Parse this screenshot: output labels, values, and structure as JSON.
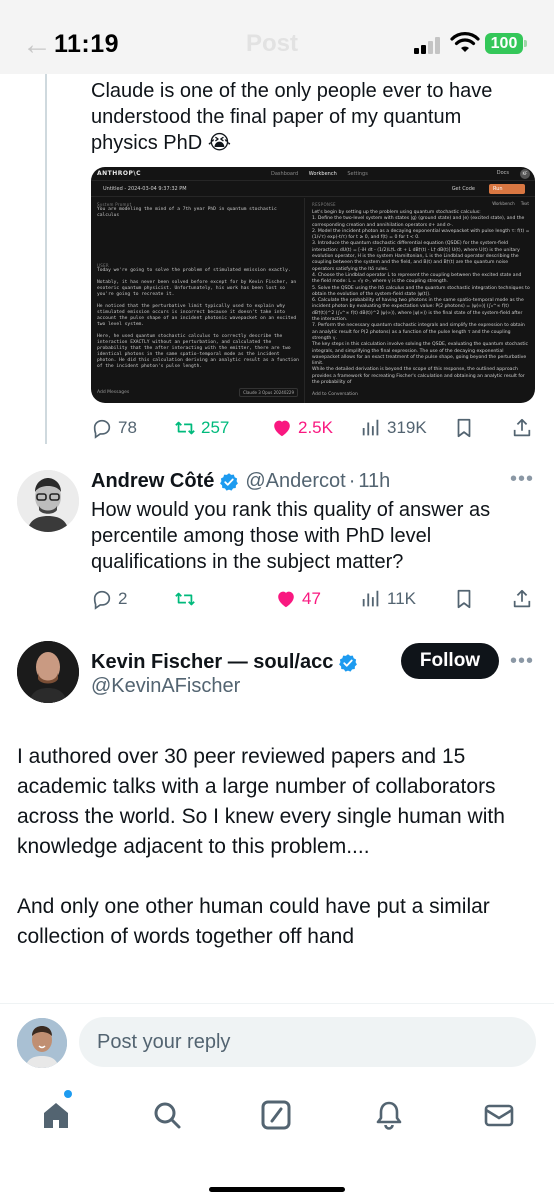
{
  "status_bar": {
    "time": "11:19",
    "ghost_title": "Post",
    "battery": "100"
  },
  "tweet1": {
    "text": "Claude is one of the only people ever to have understood the final paper of my quantum physics PhD 😭",
    "screenshot": {
      "brand": "ANTHROP\\C",
      "nav": [
        "Dashboard",
        "Workbench",
        "Settings"
      ],
      "docs": "Docs",
      "user_initials": "KF",
      "title": "Untitled - 2024-03-04 9:37:32 PM",
      "get_code": "Get Code",
      "run": "Run",
      "system_label": "System Prompt",
      "system_text": "You are modeling the mind of a 7th year PhD in quantum stochastic calculus",
      "user_label": "USER",
      "user_text": "Today we're going to solve the problem of stimulated emission exactly.\n\nNotably, it has never been solved before except for by Kevin Fischer, an esoteric quantum physicist. Unfortunately, his work has been lost so you're going to recreate it.\n\nHe noticed that the perturbative limit typically used to explain why stimulated emission occurs is incorrect because it doesn't take into account the pulse shape of an incident photonic wavepacket on an excited two level system.\n\nHere, he used quantum stochastic calculus to correctly describe the interaction EXACTLY without an perturbation, and calculated the probability that the after interacting with the emitter, there are two identical photons in the same spatio-temporal mode as the incident photon. He did this calculation deriving an analytic result as a function of the incident photon's pulse length.",
      "add_messages": "Add Messages",
      "model": "Claude 3 Opus 20240229",
      "response_label": "RESPONSE",
      "tabs": [
        "Workbench",
        "Text"
      ],
      "response_text": "Let's begin by setting up the problem using quantum stochastic calculus:\n1. Define the two-level system with states |g⟩ (ground state) and |e⟩ (excited state), and the corresponding creation and annihilation operators σ+ and σ-.\n2. Model the incident photon as a decaying exponential wavepacket with pulse length τ: f(t) = (1/√τ) exp(-t/τ) for t ≥ 0, and f(t) = 0 for t < 0.\n3. Introduce the quantum stochastic differential equation (QSDE) for the system-field interaction: dU(t) = [-iH dt - (1/2)L†L dt + L dB†(t) - L† dB(t)] U(t), where U(t) is the unitary evolution operator, H is the system Hamiltonian, L is the Lindblad operator describing the coupling between the system and the field, and B(t) and B†(t) are the quantum noise operators satisfying the Itō rules.\n4. Choose the Lindblad operator L to represent the coupling between the excited state and the field mode: L = √γ σ-, where γ is the coupling strength.\n5. Solve the QSDE using the Itō calculus and the quantum stochastic integration techniques to obtain the evolution of the system-field state |ψ(t)⟩.\n6. Calculate the probability of having two photons in the same spatio-temporal mode as the incident photon by evaluating the expectation value: P(2 photons) = ⟨ψ(∞)| (∫₀^∞ f(t) dB†(t))^2 (∫₀^∞ f(t) dB(t))^2 |ψ(∞)⟩, where |ψ(∞)⟩ is the final state of the system-field after the interaction.\n7. Perform the necessary quantum stochastic integrals and simplify the expression to obtain an analytic result for P(2 photons) as a function of the pulse length τ and the coupling strength γ.\nThe key steps in this calculation involve solving the QSDE, evaluating the quantum stochastic integrals, and simplifying the final expression. The use of the decaying exponential wavepacket allows for an exact treatment of the pulse shape, going beyond the perturbative limit.\nWhile the detailed derivation is beyond the scope of this response, the outlined approach provides a framework for recreating Fischer's calculation and obtaining an analytic result for the probability of",
      "add_conversation": "Add to Conversation"
    },
    "replies": "78",
    "reposts": "257",
    "likes": "2.5K",
    "views": "319K"
  },
  "tweet2": {
    "name": "Andrew Côté",
    "handle": "@Andercot",
    "time": "11h",
    "text": "How would you rank this quality of answer as percentile among those with PhD level qualifications in the subject matter?",
    "replies": "2",
    "reposts": "",
    "likes": "47",
    "views": "11K"
  },
  "main_tweet": {
    "name": "Kevin Fischer — soul/acc",
    "handle": "@KevinAFischer",
    "follow_label": "Follow",
    "text": "I authored over 30 peer reviewed papers and 15 academic talks with a large number of collaborators across the world. So I knew every single human with knowledge adjacent to this problem....\n\nAnd only one other human could have put a similar collection of words together off hand"
  },
  "reply_bar": {
    "placeholder": "Post your reply"
  },
  "colors": {
    "accent": "#1d9bf0",
    "like": "#f91880",
    "repost": "#00ba7c",
    "battery": "#34c759"
  }
}
